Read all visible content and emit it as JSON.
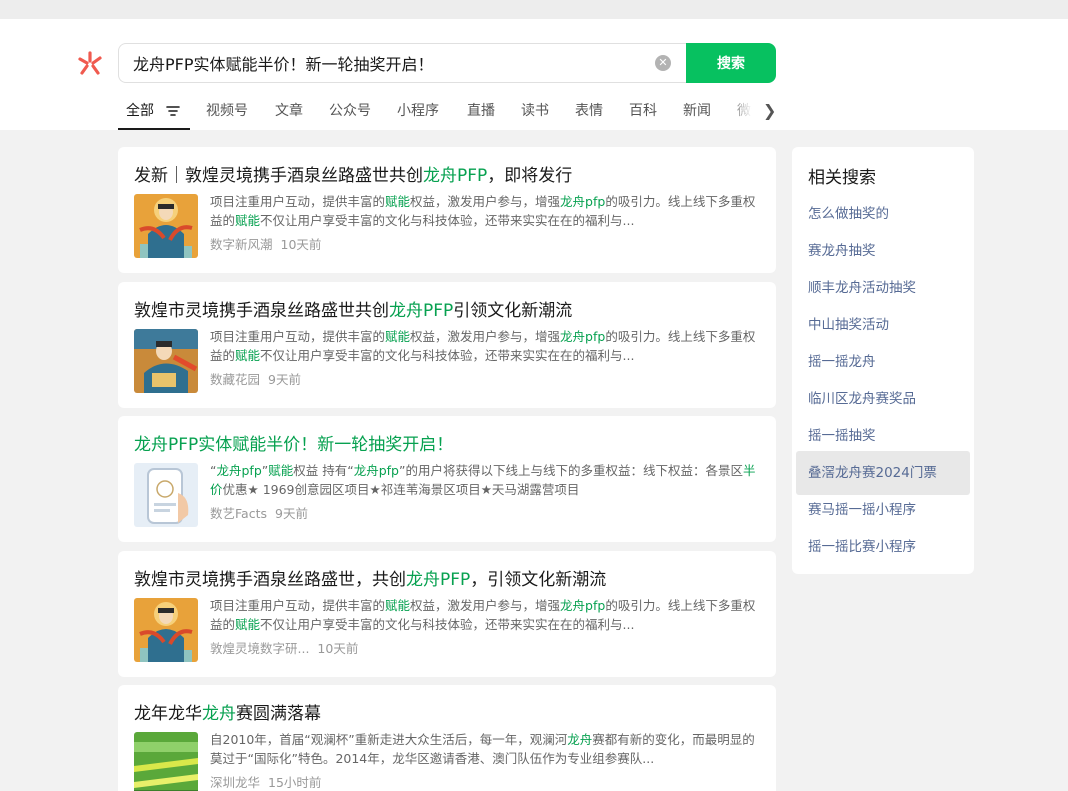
{
  "search": {
    "query": "龙舟PFP实体赋能半价！新一轮抽奖开启！",
    "button_label": "搜索"
  },
  "tabs": [
    "全部",
    "视频号",
    "文章",
    "公众号",
    "小程序",
    "直播",
    "读书",
    "表情",
    "百科",
    "新闻",
    "微信"
  ],
  "results": [
    {
      "title_parts": [
        "发新｜敦煌灵境携手酒泉丝路盛世共创",
        "龙舟PFP",
        "，即将发行"
      ],
      "snippet_parts": [
        "项目注重用户互动，提供丰富的",
        "赋能",
        "权益，激发用户参与，增强",
        "龙舟pfp",
        "的吸引力。线上线下多重权益的",
        "赋能",
        "不仅让用户享受丰富的文化与科技体验，还带来实实在在的福利与..."
      ],
      "source": "数字新风潮",
      "time": "10天前"
    },
    {
      "title_parts": [
        "敦煌市灵境携手酒泉丝路盛世共创",
        "龙舟PFP",
        "引领文化新潮流"
      ],
      "snippet_parts": [
        "项目注重用户互动，提供丰富的",
        "赋能",
        "权益，激发用户参与，增强",
        "龙舟pfp",
        "的吸引力。线上线下多重权益的",
        "赋能",
        "不仅让用户享受丰富的文化与科技体验，还带来实实在在的福利与..."
      ],
      "source": "数藏花园",
      "time": "9天前"
    },
    {
      "title": "龙舟PFP实体赋能半价！新一轮抽奖开启！",
      "snippet_parts": [
        "“",
        "龙舟pfp",
        "”",
        "赋能",
        "权益 持有“",
        "龙舟pfp",
        "”的用户将获得以下线上与线下的多重权益：线下权益：各景区",
        "半价",
        "优惠★ 1969创意园区项目★祁连苇海景区项目★天马湖露营项目"
      ],
      "source": "数艺Facts",
      "time": "9天前"
    },
    {
      "title_parts": [
        "敦煌市灵境携手酒泉丝路盛世，共创",
        "龙舟PFP",
        "，引领文化新潮流"
      ],
      "snippet_parts": [
        "项目注重用户互动，提供丰富的",
        "赋能",
        "权益，激发用户参与，增强",
        "龙舟pfp",
        "的吸引力。线上线下多重权益的",
        "赋能",
        "不仅让用户享受丰富的文化与科技体验，还带来实实在在的福利与..."
      ],
      "source": "敦煌灵境数字研...",
      "time": "10天前"
    },
    {
      "title_parts": [
        "龙年龙华",
        "龙舟",
        "赛圆满落幕"
      ],
      "snippet_parts": [
        "自2010年，首届“观澜杯”重新走进大众生活后，每一年，观澜河",
        "龙舟",
        "赛都有新的变化，而最明显的莫过于“国际化”特色。2014年，龙华区邀请香港、澳门队伍作为专业组参赛队..."
      ],
      "source": "深圳龙华",
      "time": "15小时前"
    }
  ],
  "related": {
    "title": "相关搜索",
    "items": [
      "怎么做抽奖的",
      "赛龙舟抽奖",
      "顺丰龙舟活动抽奖",
      "中山抽奖活动",
      "摇一摇龙舟",
      "临川区龙舟赛奖品",
      "摇一摇抽奖",
      "叠滘龙舟赛2024门票",
      "赛马摇一摇小程序",
      "摇一摇比赛小程序"
    ]
  },
  "colors": {
    "accent_green": "#07c160",
    "highlight_green": "#07a150",
    "related_link": "#576b95"
  }
}
